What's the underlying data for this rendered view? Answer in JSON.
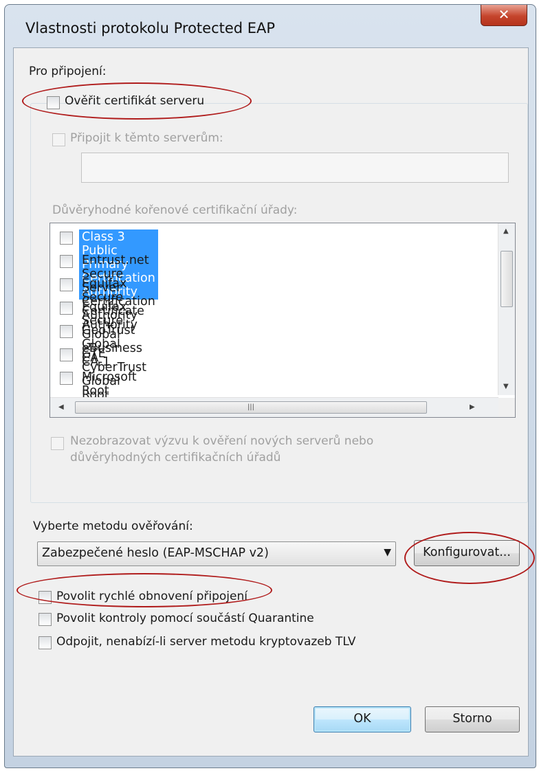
{
  "window": {
    "title": "Vlastnosti protokolu Protected EAP",
    "close_symbol": "✕"
  },
  "connection": {
    "heading": "Pro připojení:",
    "verify_cert": {
      "label": "Ověřit certifikát serveru",
      "checked": false
    },
    "connect_to_servers": {
      "label": "Připojit k těmto serverům:",
      "checked": false,
      "value": ""
    },
    "trusted_roots_label": "Důvěryhodné kořenové certifikační úřady:",
    "trusted_roots": [
      {
        "label": "Class 3 Public Primary Certification Authority",
        "checked": false,
        "selected": true
      },
      {
        "label": "Entrust.net Secure Server Certification Authority",
        "checked": false
      },
      {
        "label": "Equifax Secure Certificate Authority",
        "checked": false
      },
      {
        "label": "Equifax Secure Global eBusiness CA-1",
        "checked": false
      },
      {
        "label": "GeoTrust Global CA",
        "checked": false
      },
      {
        "label": "GTE CyberTrust Global Root",
        "checked": false
      },
      {
        "label": "Microsoft Root Authority",
        "checked": false
      }
    ],
    "no_prompt": {
      "line1": "Nezobrazovat výzvu k ověření nových serverů nebo",
      "line2": "důvěryhodných certifikačních úřadů",
      "checked": false
    }
  },
  "auth": {
    "heading": "Vyberte metodu ověřování:",
    "method": "Zabezpečené heslo (EAP-MSCHAP v2)",
    "configure_label": "Konfigurovat...",
    "fast_reconnect": {
      "label": "Povolit rychlé obnovení připojení",
      "checked": false
    },
    "quarantine": {
      "label": "Povolit kontroly pomocí součástí Quarantine",
      "checked": false
    },
    "disconnect_tlv": {
      "label": "Odpojit, nenabízí-li server metodu kryptovazeb TLV",
      "checked": false
    }
  },
  "buttons": {
    "ok": "OK",
    "cancel": "Storno"
  },
  "colors": {
    "annotation": "#b01c1c",
    "selection": "#3399ff"
  }
}
